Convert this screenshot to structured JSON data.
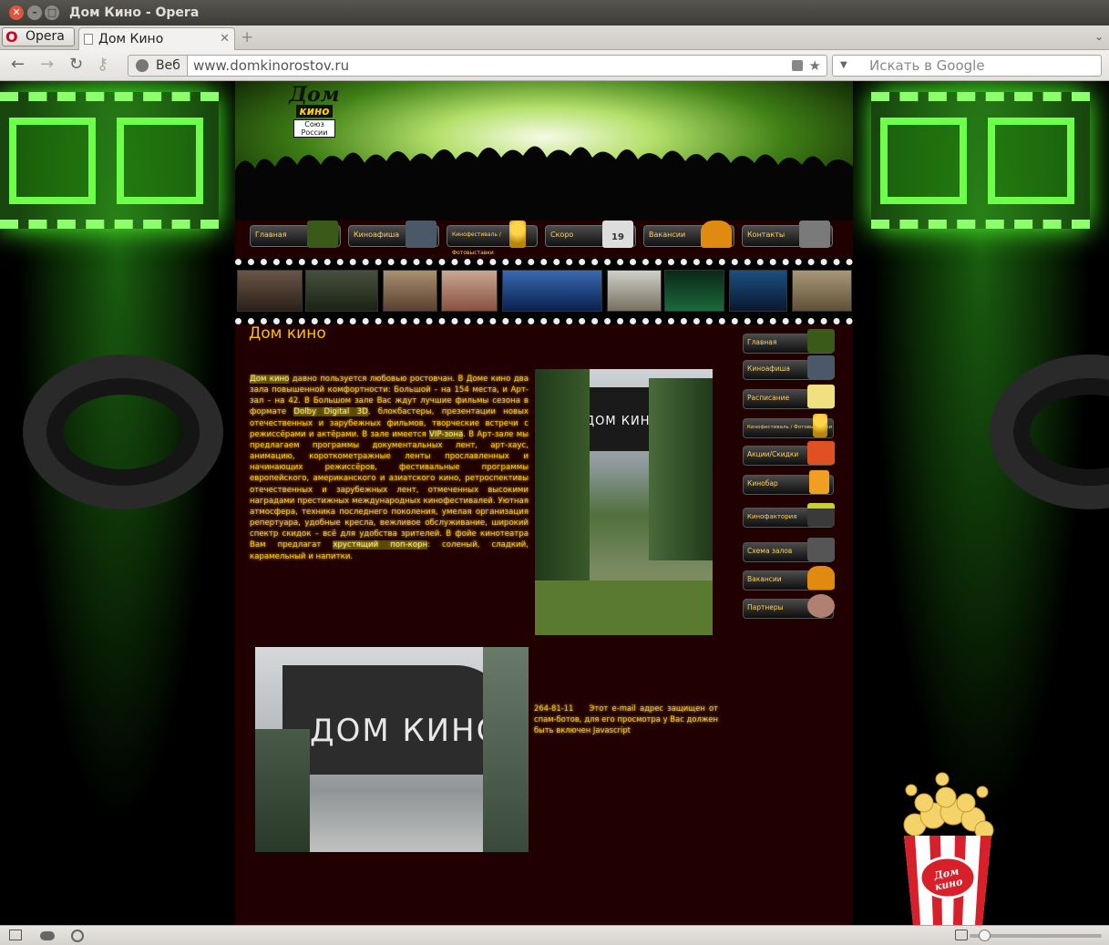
{
  "window": {
    "title": "Дом Кино - Opera"
  },
  "tabbar": {
    "menu_label": "Opera",
    "tab_title": "Дом Кино"
  },
  "addressbar": {
    "scope": "Веб",
    "url": "www.domkinorostov.ru",
    "search_placeholder": "Искать в Google"
  },
  "site": {
    "logo": {
      "line1": "Дом",
      "line2": "кино",
      "line3": "Союз",
      "line4": "России"
    },
    "topnav": [
      {
        "label": "Главная",
        "icon": "crowd-icon"
      },
      {
        "label": "Киноафиша",
        "icon": "film-3d-icon"
      },
      {
        "label": "Кинофестиваль / Фотовыставки",
        "icon": "oscar-icon"
      },
      {
        "label": "Скоро",
        "icon": "calendar-icon",
        "badge": "19"
      },
      {
        "label": "Вакансии",
        "icon": "chair-icon"
      },
      {
        "label": "Контакты",
        "icon": "phone-icon"
      }
    ],
    "page_title": "Дом кино",
    "intro": {
      "p1": "Дом кино",
      "p2": " давно пользуется любовью ростовчан. В Доме кино два зала повышенной комфортности: Большой – на 154 места, и Арт-зал – на 42. В Большом зале Вас ждут лучшие фильмы сезона в формате ",
      "p3": "Dolby Digital 3D",
      "p4": ", блокбастеры, презентации новых отечественных и зарубежных фильмов, творческие встречи с режиссёрами и актёрами. В зале имеется ",
      "p5": "VIP-зона",
      "p6": ". В Арт-зале мы предлагаем программы документальных лент, арт-хаус, анимацию, короткометражные ленты прославленных и начинающих режиссёров, фестивальные программы европейского, американского и азиатского кино, ретроспективы отечественных и зарубежных лент, отмеченных высокими наградами престижных международных кинофестивалей. Уютная атмосфера, техника последнего поколения, умелая организация репертуара, удобные кресла, вежливое обслуживание, широкий спектр скидок – всё для удобства зрителей. В фойе кинотеатра Вам предлагат ",
      "p7": "хрустящий поп-корн",
      "p8": ": соленый, сладкий, карамельный и напитки."
    },
    "contact": {
      "phone": "264-81-11",
      "email_note": "Этот e-mail адрес защищен от спам-ботов, для его просмотра у Вас должен быть включен Javascript"
    },
    "photo_sign": "ДОМ КИНО",
    "sidenav": [
      {
        "label": "Главная",
        "icon": "crowd-icon"
      },
      {
        "label": "Киноафиша",
        "icon": "film-3d-icon"
      },
      {
        "label": "Расписание",
        "icon": "notepad-icon"
      },
      {
        "label": "Кинофестиваль / Фотовыставки",
        "icon": "oscar-icon"
      },
      {
        "label": "Акции/Скидки",
        "icon": "discount-card-icon"
      },
      {
        "label": "Кинобар",
        "icon": "beer-icon"
      },
      {
        "label": "Кинофактория",
        "icon": "clapperboard-icon"
      },
      {
        "label": "Схема залов",
        "icon": "seats-icon"
      },
      {
        "label": "Вакансии",
        "icon": "chair-icon"
      },
      {
        "label": "Партнеры",
        "icon": "handshake-icon"
      }
    ],
    "popcorn_label": "Дом кино"
  },
  "colors": {
    "accent": "#ffc000",
    "content_bg": "#200000",
    "glow": "#4cff2a"
  }
}
